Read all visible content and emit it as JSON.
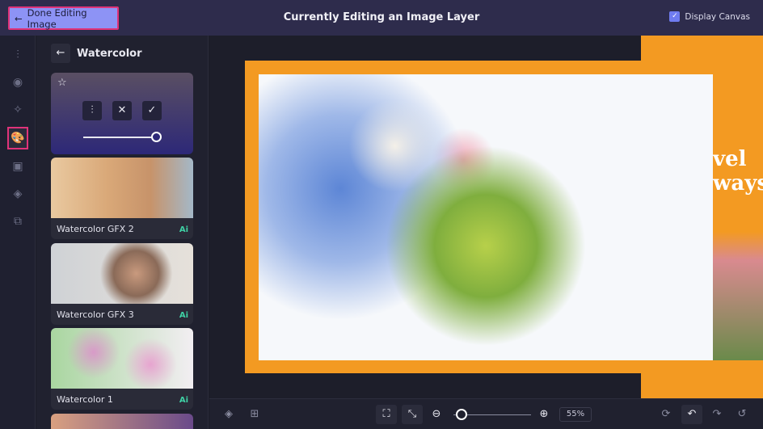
{
  "header": {
    "done_label": "Done Editing Image",
    "title": "Currently Editing an Image Layer",
    "display_canvas_label": "Display Canvas",
    "display_canvas_checked": true
  },
  "panel": {
    "title": "Watercolor",
    "effects": [
      {
        "label": "Watercolor GFX 2",
        "badge": "Ai"
      },
      {
        "label": "Watercolor GFX 3",
        "badge": "Ai"
      },
      {
        "label": "Watercolor 1",
        "badge": "Ai"
      }
    ],
    "intensity": 1.0
  },
  "canvas": {
    "side_text": [
      "vel",
      "ways"
    ]
  },
  "toolbar": {
    "zoom": "55%",
    "zoom_level": 0.1
  },
  "colors": {
    "accent": "#8d93f5",
    "highlight": "#e0337a",
    "orange": "#f39a22"
  }
}
